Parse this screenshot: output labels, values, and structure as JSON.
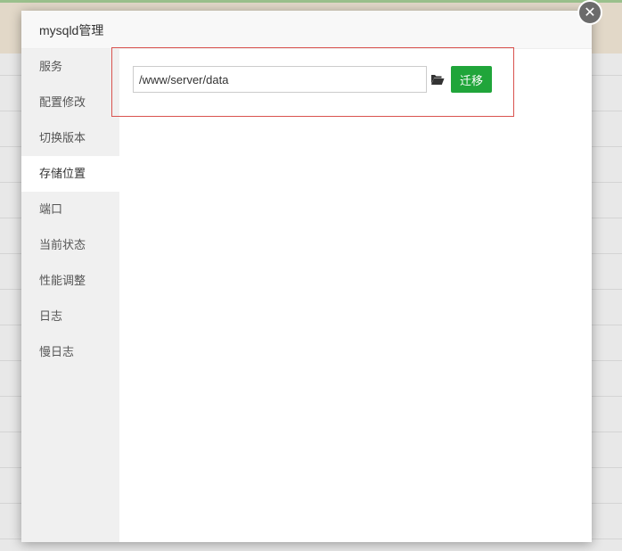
{
  "dialog": {
    "title": "mysqld管理",
    "close_icon": "close-icon"
  },
  "sidebar": {
    "items": [
      {
        "label": "服务",
        "active": false
      },
      {
        "label": "配置修改",
        "active": false
      },
      {
        "label": "切换版本",
        "active": false
      },
      {
        "label": "存储位置",
        "active": true
      },
      {
        "label": "端口",
        "active": false
      },
      {
        "label": "当前状态",
        "active": false
      },
      {
        "label": "性能调整",
        "active": false
      },
      {
        "label": "日志",
        "active": false
      },
      {
        "label": "慢日志",
        "active": false
      }
    ]
  },
  "storage": {
    "path_value": "/www/server/data",
    "folder_icon": "folder-open-icon",
    "migrate_label": "迁移"
  },
  "colors": {
    "accent_green": "#20a53a",
    "highlight_red": "#d9534f",
    "sidebar_bg": "#f0f0f0",
    "close_bg": "#6b6b6b"
  }
}
